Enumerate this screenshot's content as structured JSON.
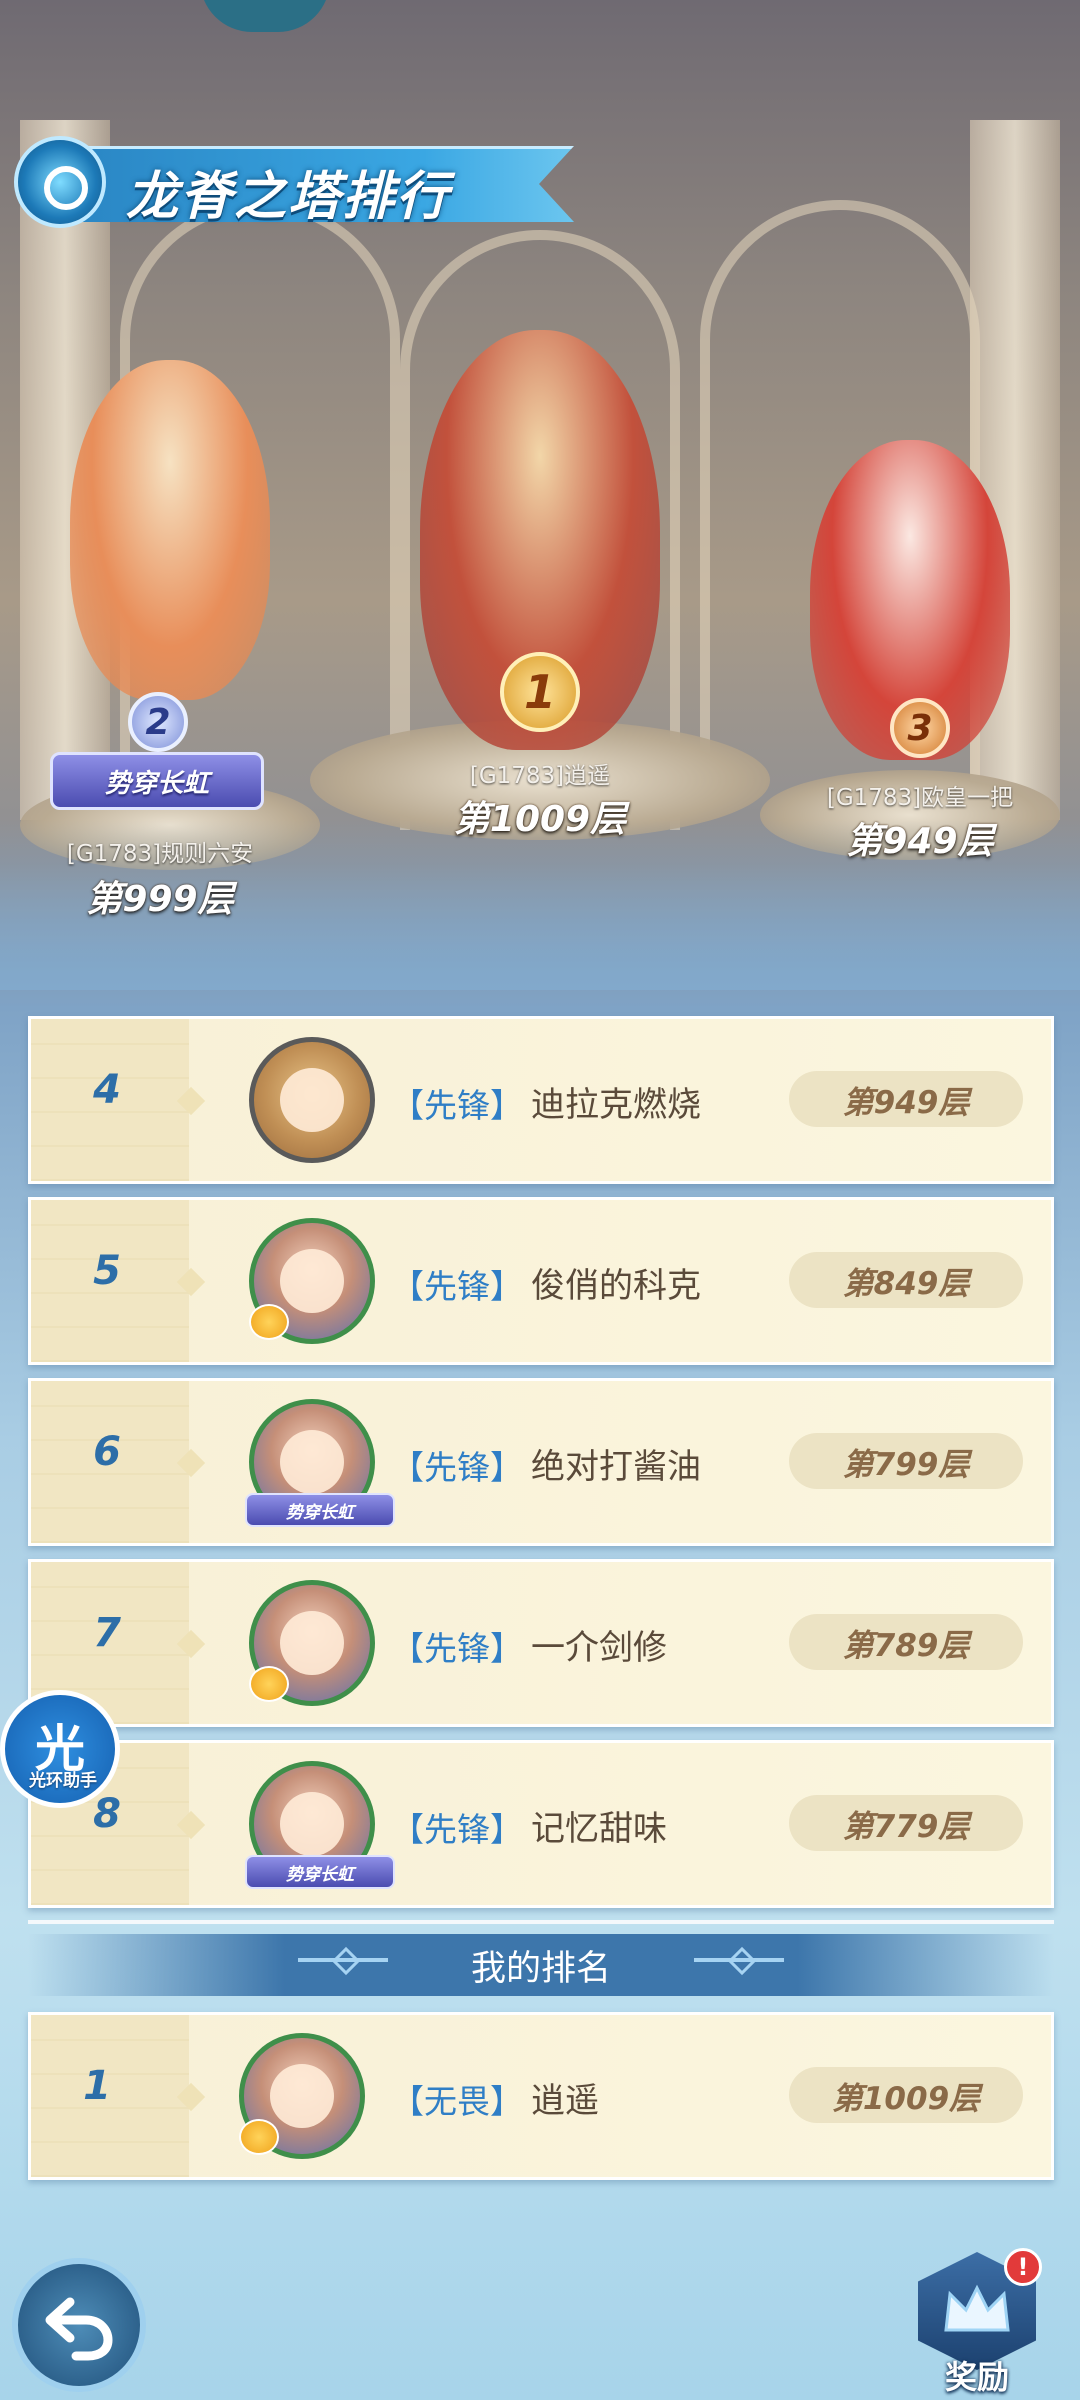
{
  "header": {
    "title": "龙脊之塔排行"
  },
  "podium": [
    {
      "rank": "1",
      "name": "[G1783]逍遥",
      "floor": "第1009层"
    },
    {
      "rank": "2",
      "name": "[G1783]规则六安",
      "floor": "第999层",
      "title_badge": "势穿长虹"
    },
    {
      "rank": "3",
      "name": "[G1783]欧皇一把",
      "floor": "第949层"
    }
  ],
  "ranking": [
    {
      "rank": "4",
      "tag": "【先锋】",
      "name": "迪拉克燃烧",
      "floor": "第949层",
      "avatar": "bear-avatar"
    },
    {
      "rank": "5",
      "tag": "【先锋】",
      "name": "俊俏的科克",
      "floor": "第849层",
      "avatar": "hero-avatar"
    },
    {
      "rank": "6",
      "tag": "【先锋】",
      "name": "绝对打酱油",
      "floor": "第799层",
      "avatar": "hero-avatar",
      "avatar_badge": "势穿长虹"
    },
    {
      "rank": "7",
      "tag": "【先锋】",
      "name": "一介剑修",
      "floor": "第789层",
      "avatar": "hero-avatar"
    },
    {
      "rank": "8",
      "tag": "【先锋】",
      "name": "记忆甜味",
      "floor": "第779层",
      "avatar": "hero-avatar",
      "avatar_badge": "势穿长虹"
    }
  ],
  "my_rank": {
    "label": "我的排名",
    "rank": "1",
    "tag": "【无畏】",
    "name": "逍遥",
    "floor": "第1009层"
  },
  "helper": {
    "glyph": "光",
    "label": "光环助手"
  },
  "footer": {
    "reward_label": "奖励",
    "reward_badge": "!"
  },
  "colors": {
    "accent_blue": "#2d6ea8",
    "tag_blue": "#2f7ec6",
    "row_bg": "#f8f0d6",
    "pill_bg": "#ece3c4"
  }
}
